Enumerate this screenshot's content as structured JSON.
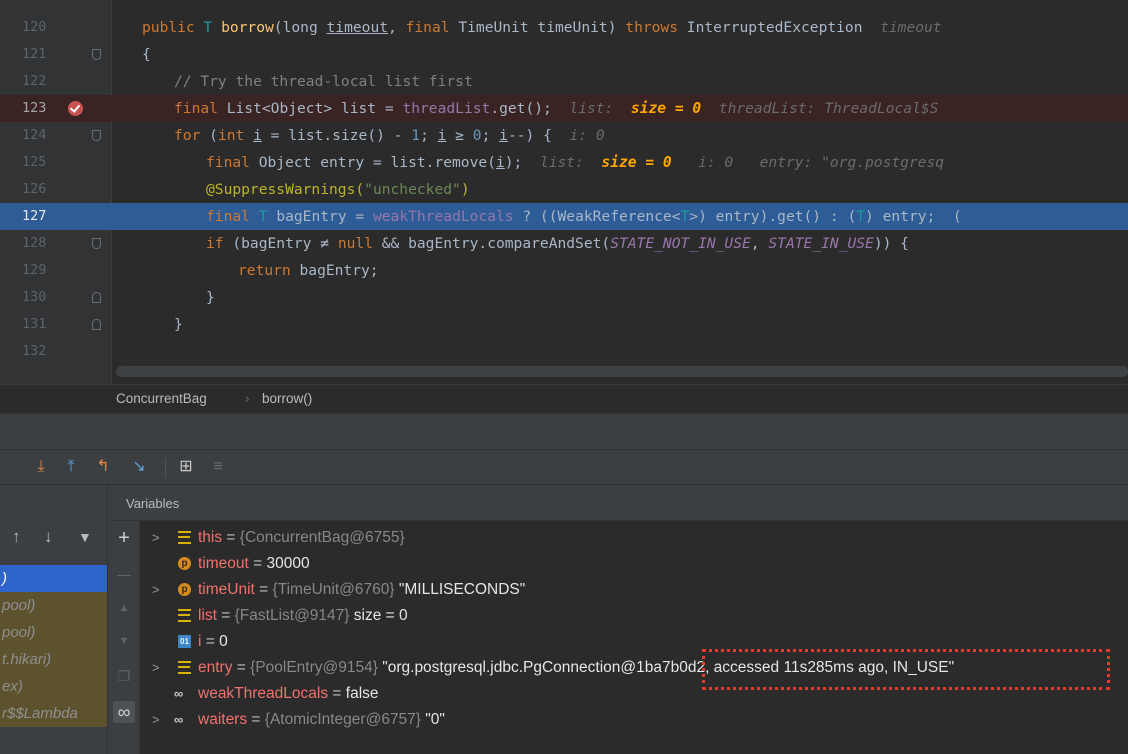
{
  "editor": {
    "lines": [
      {
        "num": "120",
        "kind": "normal"
      },
      {
        "num": "121",
        "kind": "normal"
      },
      {
        "num": "122",
        "kind": "normal"
      },
      {
        "num": "123",
        "kind": "breakpoint"
      },
      {
        "num": "124",
        "kind": "normal"
      },
      {
        "num": "125",
        "kind": "normal"
      },
      {
        "num": "126",
        "kind": "normal"
      },
      {
        "num": "127",
        "kind": "exec"
      },
      {
        "num": "128",
        "kind": "normal"
      },
      {
        "num": "129",
        "kind": "normal"
      },
      {
        "num": "130",
        "kind": "normal"
      },
      {
        "num": "131",
        "kind": "normal"
      },
      {
        "num": "132",
        "kind": "normal"
      }
    ],
    "code": {
      "l120": [
        "public",
        " T ",
        "borrow",
        "(long ",
        "timeout",
        ", ",
        "final",
        " TimeUnit timeUnit) ",
        "throws",
        " InterruptedException  ",
        "timeout"
      ],
      "l121": [
        "{"
      ],
      "l122": [
        "// Try the thread-local list first"
      ],
      "l123": [
        "final",
        " List<Object> list = ",
        "threadList",
        ".get();  ",
        "list:  ",
        "size = 0",
        "  threadList: ThreadLocal$S"
      ],
      "l124": [
        "for",
        " (",
        "int",
        " ",
        "i",
        " = list.size() - ",
        "1",
        "; ",
        "i",
        " ≥ ",
        "0",
        "; ",
        "i",
        "--) {  ",
        "i: 0"
      ],
      "l125": [
        "final",
        " Object entry = list.remove(",
        "i",
        ");  ",
        "list:  ",
        "size = 0",
        "   i: 0   entry: \"org.postgresq"
      ],
      "l126": [
        "@SuppressWarnings(",
        "\"unchecked\"",
        ")"
      ],
      "l127": [
        "final",
        " ",
        "T",
        " bagEntry = ",
        "weakThreadLocals",
        " ? ((WeakReference<",
        "T",
        ">) entry).get() : (",
        "T",
        ") entry;  ("
      ],
      "l128": [
        "if",
        " (bagEntry ≠ ",
        "null",
        " && bagEntry.compareAndSet(",
        "STATE_NOT_IN_USE",
        ", ",
        "STATE_IN_USE",
        ")) {"
      ],
      "l129": [
        "return",
        " bagEntry;"
      ],
      "l130": [
        "}"
      ],
      "l131": [
        "}"
      ],
      "l132": [
        ""
      ]
    }
  },
  "breadcrumb": {
    "class_name": "ConcurrentBag",
    "separator": "›",
    "method_name": "borrow()"
  },
  "toolbar": {
    "step_into": "⤓",
    "step_out": "⤒",
    "drop_frame": "↰",
    "run_to_cursor": "↘",
    "evaluate": "⊞",
    "trace": "≡"
  },
  "frames": {
    "tools": {
      "up": "↑",
      "down": "↓",
      "filter": "▼"
    },
    "items": [
      {
        "label": ")",
        "state": "selected"
      },
      {
        "label": "pool)",
        "state": "lib"
      },
      {
        "label": "pool)",
        "state": "lib"
      },
      {
        "label": "t.hikari)",
        "state": "lib"
      },
      {
        "label": "ex)",
        "state": "lib"
      },
      {
        "label": "r$$Lambda",
        "state": "lib"
      }
    ]
  },
  "side_actions": {
    "add": "+",
    "minus": "—",
    "up": "▲",
    "down": "▼",
    "copy": "❐",
    "watch": "∞"
  },
  "variables": {
    "title": "Variables",
    "items": [
      {
        "expandable": true,
        "icon": "field-icon",
        "name": "this",
        "eq": " = ",
        "ref": "{ConcurrentBag@6755}",
        "value": ""
      },
      {
        "expandable": false,
        "icon": "param-icon",
        "name": "timeout",
        "eq": " = ",
        "ref": "",
        "value": "30000"
      },
      {
        "expandable": true,
        "icon": "param-icon",
        "name": "timeUnit",
        "eq": " = ",
        "ref": "{TimeUnit@6760}",
        "value": " \"MILLISECONDS\""
      },
      {
        "expandable": false,
        "icon": "field-icon",
        "name": "list",
        "eq": " = ",
        "ref": "{FastList@9147}",
        "value": "  size = 0"
      },
      {
        "expandable": false,
        "icon": "primitive-icon",
        "name": "i",
        "eq": " = ",
        "ref": "",
        "value": "0"
      },
      {
        "expandable": true,
        "icon": "field-icon",
        "name": "entry",
        "eq": " = ",
        "ref": "{PoolEntry@9154}",
        "value": " \"org.postgresql.jdbc.PgConnection@1ba7b0d2, accessed 11s285ms ago, IN_USE\""
      },
      {
        "expandable": false,
        "icon": "watch-icon",
        "name": "weakThreadLocals",
        "eq": " = ",
        "ref": "",
        "value": "false"
      },
      {
        "expandable": true,
        "icon": "watch-icon",
        "name": "waiters",
        "eq": " = ",
        "ref": "{AtomicInteger@6757}",
        "value": " \"0\""
      }
    ],
    "expand_glyph": ">",
    "param_glyph": "p",
    "primitive_glyph": "01",
    "watch_glyph": "∞"
  }
}
